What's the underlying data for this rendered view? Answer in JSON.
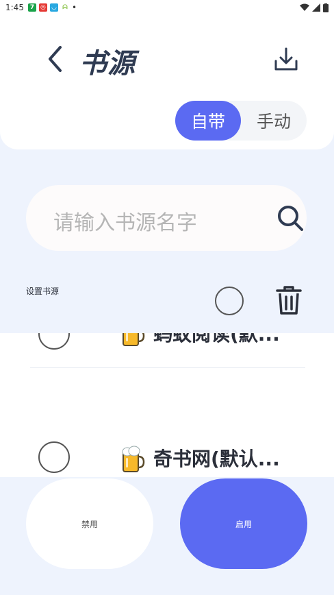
{
  "status_bar": {
    "time": "1:45",
    "app_icons": [
      {
        "name": "app-7-icon",
        "glyph": "7",
        "color": "#1aa34a"
      },
      {
        "name": "app-red-icon",
        "glyph": "◎",
        "color": "#e53935"
      },
      {
        "name": "app-chat-icon",
        "glyph": "◡",
        "color": "#29a8e0"
      },
      {
        "name": "android-icon",
        "glyph": "ᗣ",
        "color": "#8bc34a"
      }
    ],
    "dot": "•"
  },
  "header": {
    "title": "书源",
    "segment": {
      "builtin": "自带",
      "manual": "手动"
    }
  },
  "search": {
    "placeholder": "请输入书源名字"
  },
  "toolbar": {
    "set_label": "设置书源"
  },
  "list": {
    "items": [
      {
        "name": "蚂蚁阅读(默..."
      },
      {
        "name": "奇书网(默认..."
      }
    ]
  },
  "actions": {
    "disable": "禁用",
    "enable": "启用"
  },
  "colors": {
    "accent": "#5b6af2",
    "title": "#2f3b52",
    "background": "#eef3fd"
  }
}
